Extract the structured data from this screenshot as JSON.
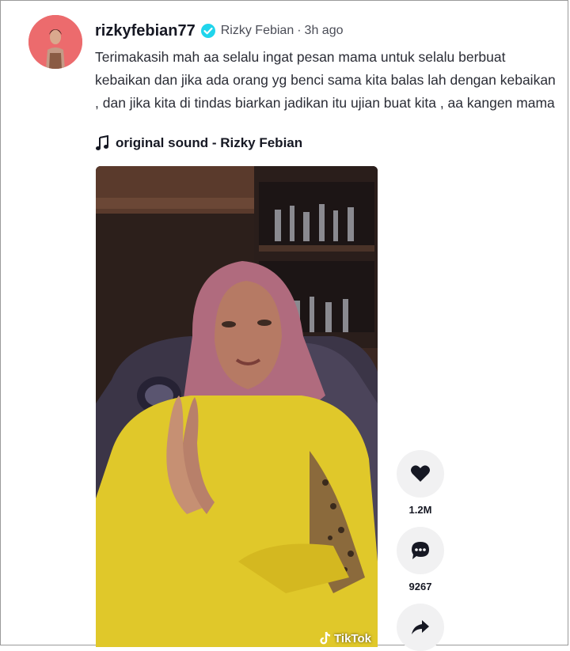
{
  "post": {
    "username": "rizkyfebian77",
    "nickname": "Rizky Febian",
    "separator": "·",
    "time": "3h ago",
    "caption": "Terimakasih mah aa selalu ingat pesan mama untuk selalu berbuat kebaikan dan jika ada orang yg benci sama kita balas lah dengan kebaikan , dan jika kita di tindas biarkan jadikan itu ujian buat kita , aa kangen mama",
    "sound": "original sound - Rizky Febian"
  },
  "video": {
    "watermark": "TikTok"
  },
  "actions": {
    "likes": "1.2M",
    "comments": "9267"
  },
  "colors": {
    "verified": "#20d5ec",
    "hijab": "#b06b7e",
    "shirt": "#e0c82a",
    "avatar_bg": "#ec6b6d"
  },
  "icons": {
    "verified": "verified-badge-icon",
    "sound": "music-note-icon",
    "like": "heart-icon",
    "comment": "comment-icon",
    "share": "share-icon"
  }
}
